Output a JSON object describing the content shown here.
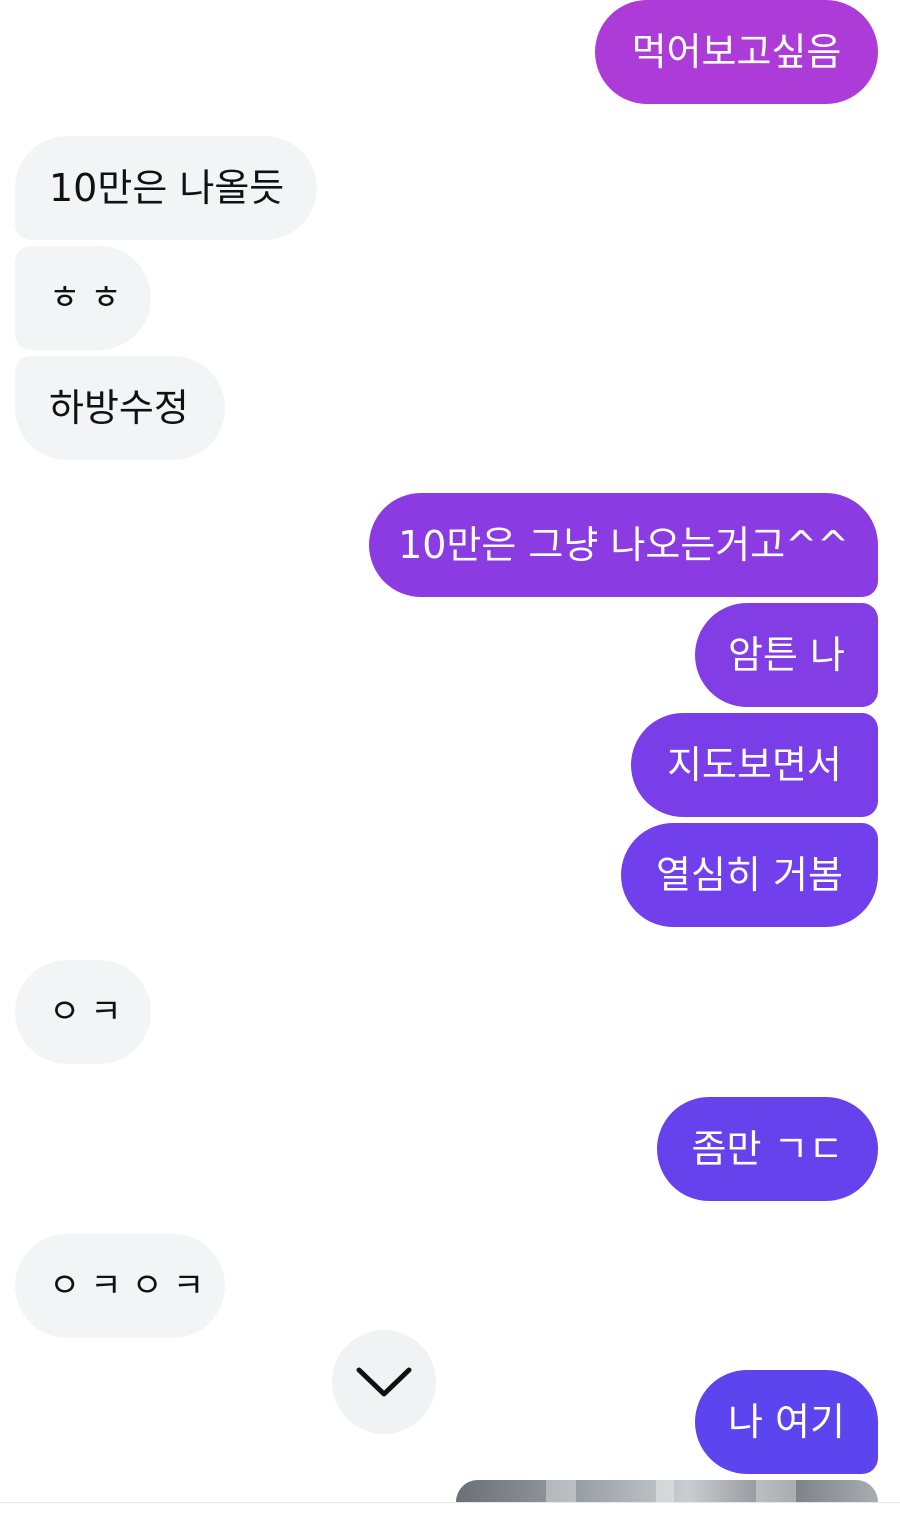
{
  "colors": {
    "received_bg": "#f3f4f6",
    "received_text": "#111111",
    "sent_text": "#ffffff",
    "sent_gradient_top": "#b13ad6",
    "sent_gradient_bottom": "#5a3ff0"
  },
  "messages": [
    {
      "sender": "me",
      "text": "먹어보고싶음"
    },
    {
      "sender": "other",
      "text": "10만은 나올듯"
    },
    {
      "sender": "other",
      "text": "ㅎㅎ"
    },
    {
      "sender": "other",
      "text": "하방수정"
    },
    {
      "sender": "me",
      "text": "10만은 그냥 나오는거고^^"
    },
    {
      "sender": "me",
      "text": "암튼 나"
    },
    {
      "sender": "me",
      "text": "지도보면서"
    },
    {
      "sender": "me",
      "text": "열심히 거봄"
    },
    {
      "sender": "other",
      "text": "ㅇㅋ"
    },
    {
      "sender": "me",
      "text": "좀만 ㄱㄷ"
    },
    {
      "sender": "other",
      "text": "ㅇㅋㅇㅋ"
    },
    {
      "sender": "me",
      "text": "나 여기"
    }
  ],
  "scroll_button": {
    "icon": "chevron-down-icon"
  },
  "attachment": {
    "type": "image"
  }
}
